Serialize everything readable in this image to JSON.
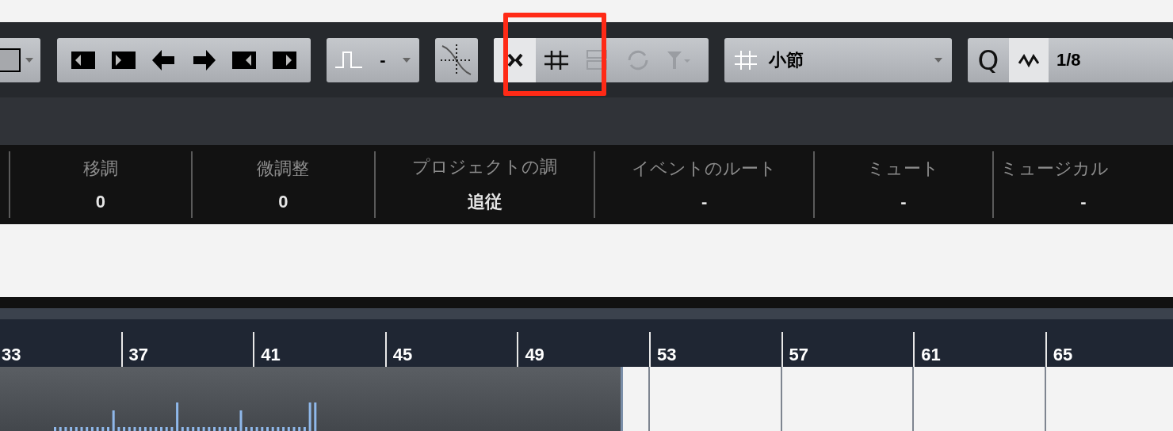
{
  "toolbar": {
    "nudge_buttons": [
      {
        "kind": "trim-start-left"
      },
      {
        "kind": "trim-start-right"
      },
      {
        "kind": "move-left"
      },
      {
        "kind": "move-right"
      },
      {
        "kind": "trim-end-left"
      },
      {
        "kind": "trim-end-right"
      }
    ],
    "step_value": "-",
    "snap_buttons": [
      {
        "kind": "cross",
        "selected": true,
        "disabled": false
      },
      {
        "kind": "grid",
        "selected": false,
        "disabled": false
      },
      {
        "kind": "events",
        "selected": false,
        "disabled": true
      },
      {
        "kind": "cycle",
        "selected": false,
        "disabled": true
      },
      {
        "kind": "magnet",
        "selected": false,
        "disabled": true
      }
    ],
    "grid_type": "小節",
    "quantize": {
      "label": "Q",
      "swing_on": true,
      "value": "1/8"
    }
  },
  "info_line": [
    {
      "label": "移調",
      "value": "0"
    },
    {
      "label": "微調整",
      "value": "0"
    },
    {
      "label": "プロジェクトの調",
      "value": "追従"
    },
    {
      "label": "イベントのルート",
      "value": "-"
    },
    {
      "label": "ミュート",
      "value": "-"
    },
    {
      "label": "ミュージカル",
      "value": "-"
    }
  ],
  "ruler": {
    "bars": [
      "33",
      "37",
      "41",
      "45",
      "49",
      "53",
      "57",
      "61",
      "65"
    ]
  }
}
